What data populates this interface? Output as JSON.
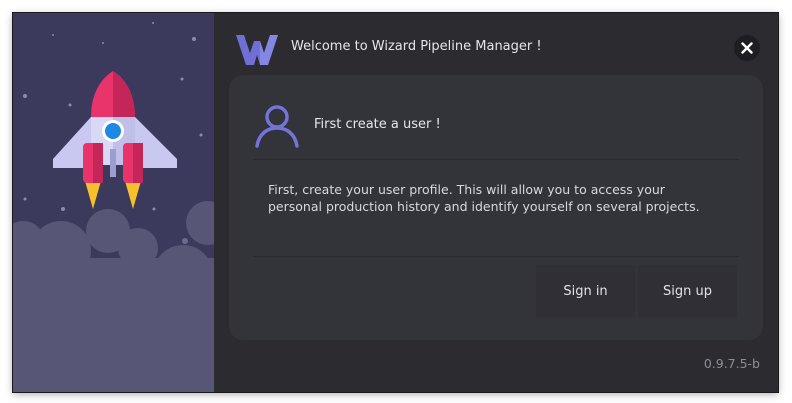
{
  "colors": {
    "accent": "#6f6fd6",
    "window_bg": "#2b2b30",
    "card_bg": "#33333a",
    "sidebar_bg": "#3b3a5c",
    "rocket_body": "#e8336b",
    "rocket_window": "#1e88e5",
    "rocket_flame": "#f5c02c"
  },
  "icons": {
    "logo": "wizard-w-logo",
    "close": "close-x",
    "user": "user-outline",
    "illustration": "rocket-night-sky"
  },
  "header": {
    "title": "Welcome to Wizard Pipeline Manager !"
  },
  "card": {
    "title": "First create a user !",
    "description": "First, create your user profile. This will allow you to access your personal production history and identify yourself on several projects.",
    "signin_label": "Sign in",
    "signup_label": "Sign up"
  },
  "footer": {
    "version": "0.9.7.5-b"
  }
}
